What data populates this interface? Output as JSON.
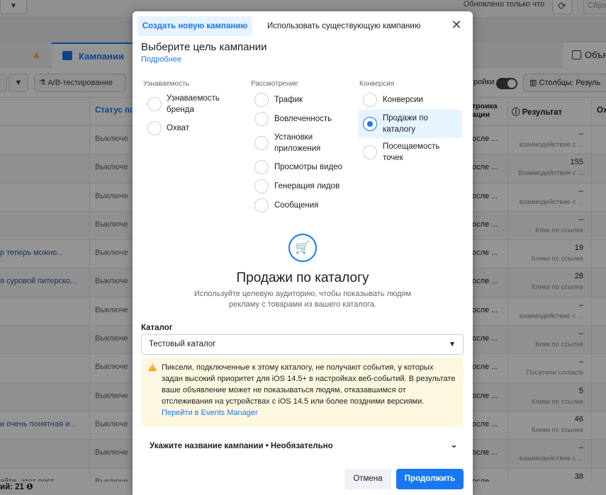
{
  "background": {
    "updated_text": "Обновлено только что",
    "reset_label": "Сбро",
    "tabs": {
      "campaigns": "Кампании",
      "ads": "Объя"
    },
    "toolbar": {
      "ab_test": "A/B-тестирование",
      "settings_partial": "ройки",
      "columns": "Столбцы: Резуль"
    },
    "headers": {
      "status": "Статус по",
      "setting": "троика ации",
      "result": "Результат",
      "extra": "Ох"
    },
    "rows": [
      {
        "name": "",
        "status": "Выключе",
        "setting": "осле ...",
        "result": "–",
        "result_sub": "взаимодействие с ..."
      },
      {
        "name": "",
        "status": "Выключе",
        "setting": "осле ...",
        "result": "155",
        "result_sub": "Взаимодействия с ..."
      },
      {
        "name": "",
        "status": "Выключе",
        "setting": "осле ...",
        "result": "–",
        "result_sub": "взаимодействие с ..."
      },
      {
        "name": "",
        "status": "Выключе",
        "setting": "осле ...",
        "result": "–",
        "result_sub": "Клик по ссылке"
      },
      {
        "name": "р теперь можно...",
        "status": "Выключе",
        "setting": "осле ...",
        "result": "19",
        "result_sub": "Клики по ссылке"
      },
      {
        "name": "я суровой питерско...",
        "status": "Выключе",
        "setting": "осле ...",
        "result": "28",
        "result_sub": "Клики по ссылке"
      },
      {
        "name": "",
        "status": "Выключе",
        "setting": "осле ...",
        "result": "–",
        "result_sub": "взаимодействие с ..."
      },
      {
        "name": "",
        "status": "Выключе",
        "setting": "осле ...",
        "result": "–",
        "result_sub": "Клик по ссылке"
      },
      {
        "name": "",
        "status": "Выключе",
        "setting": "осле ...",
        "result": "–",
        "result_sub": "Посетили contacts"
      },
      {
        "name": "",
        "status": "Выключе",
        "setting": "осле ...",
        "result": "5",
        "result_sub": "Клики по ссылке"
      },
      {
        "name": "и очень понятная и...",
        "status": "Выключе",
        "setting": "осле ...",
        "result": "46",
        "result_sub": "Клики по ссылке"
      },
      {
        "name": "",
        "status": "Выключе",
        "setting": "осле ...",
        "result": "–",
        "result_sub": "взаимодействие с ..."
      },
      {
        "name": "айте, этот пост...",
        "status": "Выключе",
        "setting": "осле ...",
        "result": "38",
        "result_sub": ""
      }
    ],
    "footer": "ий: 21"
  },
  "modal": {
    "tab_new": "Создать новую кампанию",
    "tab_existing": "Использовать существующую кампанию",
    "heading": "Выберите цель кампании",
    "learn_more": "Подробнее",
    "columns": [
      {
        "title": "Узнаваемость",
        "options": [
          "Узнаваемость бренда",
          "Охват"
        ]
      },
      {
        "title": "Рассмотрение",
        "options": [
          "Трафик",
          "Вовлеченность",
          "Установки приложения",
          "Просмотры видео",
          "Генерация лидов",
          "Сообщения"
        ]
      },
      {
        "title": "Конверсия",
        "options": [
          "Конверсии",
          "Продажи по каталогу",
          "Посещаемость точек"
        ]
      }
    ],
    "selected_option": "Продажи по каталогу",
    "selected_title": "Продажи по каталогу",
    "selected_description": "Используйте целевую аудиторию, чтобы показывать людям рекламу с товарами из вашего каталога.",
    "catalog_label": "Каталог",
    "catalog_value": "Тестовый каталог",
    "warning_text": "Пиксели, подключенные к этому каталогу, не получают события, у которых задан высокий приоритет для iOS 14.5+ в настройках веб-событий. В результате ваше объявление может не показываться людям, отказавшимся от отслеживания на устройствах с iOS 14.5 или более поздними версиями.",
    "warning_link": "Перейти в Events Manager",
    "campaign_name_label": "Укажите название кампании • Необязательно",
    "cancel": "Отмена",
    "continue": "Продолжить"
  },
  "colors": {
    "accent": "#1877f2",
    "warning_bg": "#fff8e1",
    "warning_icon": "#f5a623"
  }
}
